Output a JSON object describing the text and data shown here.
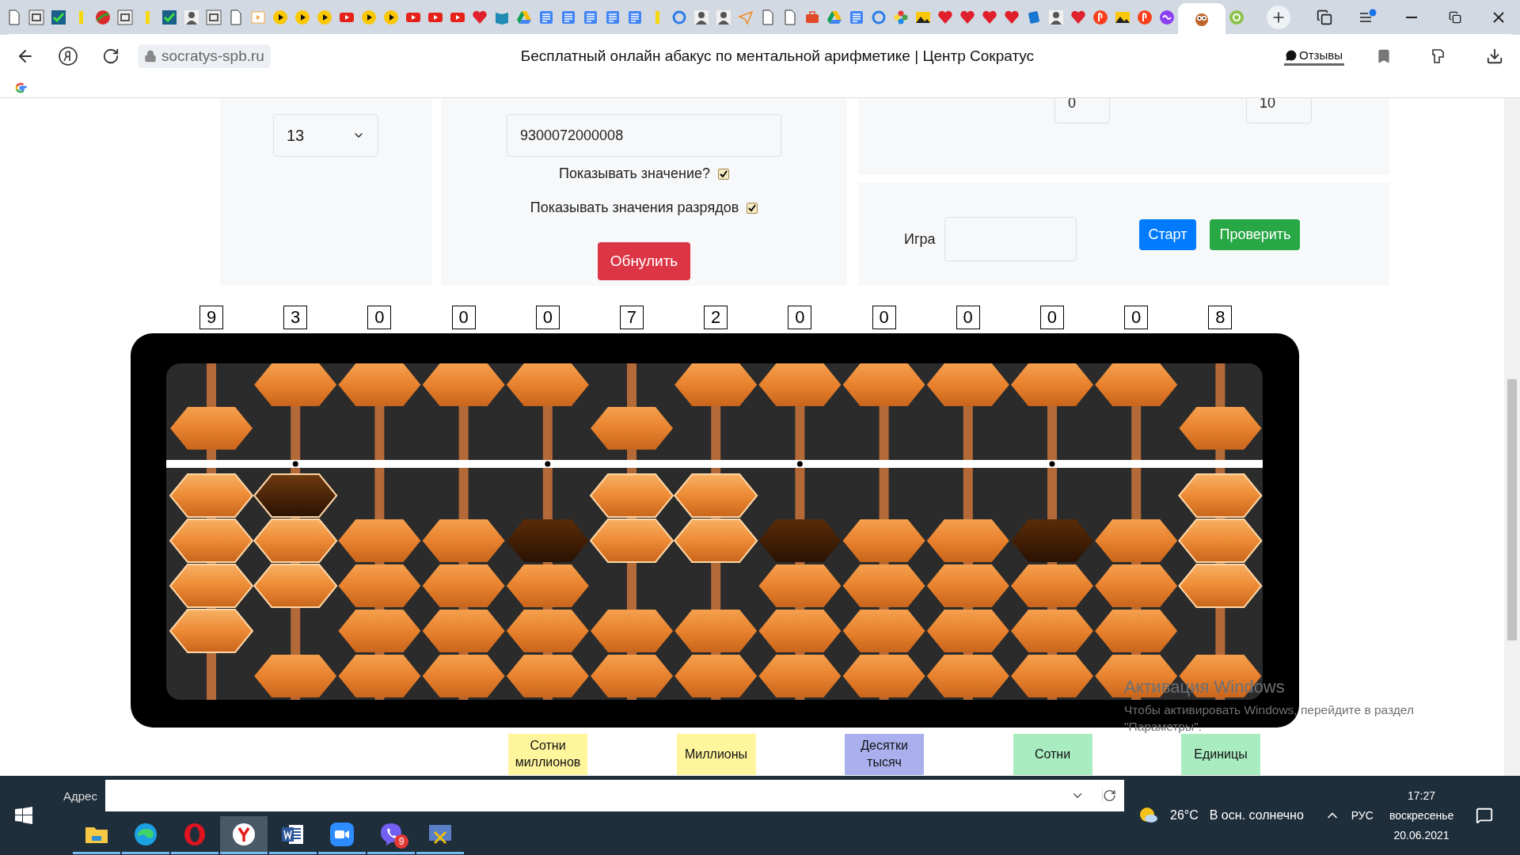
{
  "browser": {
    "tabs": [
      {
        "kind": "doc",
        "selected": false
      },
      {
        "kind": "letter",
        "selected": false
      },
      {
        "kind": "check",
        "selected": false
      },
      {
        "kind": "bar",
        "selected": false
      },
      {
        "kind": "ball",
        "selected": false
      },
      {
        "kind": "letter",
        "selected": false
      },
      {
        "kind": "bar",
        "selected": false
      },
      {
        "kind": "check",
        "selected": false
      },
      {
        "kind": "figure",
        "selected": false
      },
      {
        "kind": "letter",
        "selected": false
      },
      {
        "kind": "doc",
        "selected": false
      },
      {
        "kind": "slides",
        "selected": false
      },
      {
        "kind": "play",
        "selected": false
      },
      {
        "kind": "play",
        "selected": false
      },
      {
        "kind": "play",
        "selected": false
      },
      {
        "kind": "video",
        "selected": false
      },
      {
        "kind": "play",
        "selected": false
      },
      {
        "kind": "play",
        "selected": false
      },
      {
        "kind": "video",
        "selected": false
      },
      {
        "kind": "video",
        "selected": false
      },
      {
        "kind": "video",
        "selected": false
      },
      {
        "kind": "heart",
        "selected": false
      },
      {
        "kind": "book",
        "selected": false
      },
      {
        "kind": "drive",
        "selected": false
      },
      {
        "kind": "docs",
        "selected": false
      },
      {
        "kind": "docs",
        "selected": false
      },
      {
        "kind": "docs",
        "selected": false
      },
      {
        "kind": "docs",
        "selected": false
      },
      {
        "kind": "docs",
        "selected": false
      },
      {
        "kind": "bar",
        "selected": false
      },
      {
        "kind": "ring",
        "selected": false
      },
      {
        "kind": "figure",
        "selected": false
      },
      {
        "kind": "figure",
        "selected": false
      },
      {
        "kind": "plane",
        "selected": false
      },
      {
        "kind": "doc",
        "selected": false
      },
      {
        "kind": "doc",
        "selected": false
      },
      {
        "kind": "briefcase",
        "selected": false
      },
      {
        "kind": "drive",
        "selected": false
      },
      {
        "kind": "docs",
        "selected": false
      },
      {
        "kind": "ring",
        "selected": false
      },
      {
        "kind": "flower",
        "selected": false
      },
      {
        "kind": "image",
        "selected": false
      },
      {
        "kind": "heart",
        "selected": false
      },
      {
        "kind": "heart",
        "selected": false
      },
      {
        "kind": "heart",
        "selected": false
      },
      {
        "kind": "heart",
        "selected": false
      },
      {
        "kind": "card",
        "selected": false
      },
      {
        "kind": "figure",
        "selected": false
      },
      {
        "kind": "heart",
        "selected": false
      },
      {
        "kind": "ya",
        "selected": false
      },
      {
        "kind": "image",
        "selected": false
      },
      {
        "kind": "ya",
        "selected": false
      },
      {
        "kind": "swirl",
        "selected": false
      },
      {
        "kind": "owl",
        "selected": true
      },
      {
        "kind": "green",
        "selected": false
      }
    ],
    "address": "socratys-spb.ru",
    "page_title": "Бесплатный онлайн абакус по ментальной арифметике | Центр Сократус",
    "reviews_button": "Отзывы"
  },
  "settings": {
    "digits_select": "13",
    "value_input": "9300072000008",
    "options": [
      {
        "label": "Показывать значение?",
        "checked": true
      },
      {
        "label": "Показывать значения разрядов",
        "checked": true
      }
    ],
    "reset_button": "Обнулить",
    "range_from": "0",
    "range_to": "10",
    "game_label": "Игра",
    "start_button": "Старт",
    "check_button": "Проверить"
  },
  "abacus": {
    "columns": [
      {
        "digit": "9",
        "upper_down": true,
        "unit_dot": false,
        "lower": [
          {
            "up": true,
            "dark": false
          },
          {
            "up": true,
            "dark": false
          },
          {
            "up": true,
            "dark": false
          },
          {
            "up": true,
            "dark": false
          }
        ]
      },
      {
        "digit": "3",
        "upper_down": false,
        "unit_dot": true,
        "lower": [
          {
            "up": true,
            "dark": true
          },
          {
            "up": true,
            "dark": false
          },
          {
            "up": true,
            "dark": false
          },
          {
            "up": false,
            "dark": false
          }
        ]
      },
      {
        "digit": "0",
        "upper_down": false,
        "unit_dot": false,
        "lower": [
          {
            "up": false,
            "dark": false
          },
          {
            "up": false,
            "dark": false
          },
          {
            "up": false,
            "dark": false
          },
          {
            "up": false,
            "dark": false
          }
        ]
      },
      {
        "digit": "0",
        "upper_down": false,
        "unit_dot": false,
        "lower": [
          {
            "up": false,
            "dark": false
          },
          {
            "up": false,
            "dark": false
          },
          {
            "up": false,
            "dark": false
          },
          {
            "up": false,
            "dark": false
          }
        ]
      },
      {
        "digit": "0",
        "upper_down": false,
        "unit_dot": true,
        "lower": [
          {
            "up": false,
            "dark": true
          },
          {
            "up": false,
            "dark": false
          },
          {
            "up": false,
            "dark": false
          },
          {
            "up": false,
            "dark": false
          }
        ]
      },
      {
        "digit": "7",
        "upper_down": true,
        "unit_dot": false,
        "lower": [
          {
            "up": true,
            "dark": false
          },
          {
            "up": true,
            "dark": false
          },
          {
            "up": false,
            "dark": false
          },
          {
            "up": false,
            "dark": false
          }
        ]
      },
      {
        "digit": "2",
        "upper_down": false,
        "unit_dot": false,
        "lower": [
          {
            "up": true,
            "dark": false
          },
          {
            "up": true,
            "dark": false
          },
          {
            "up": false,
            "dark": false
          },
          {
            "up": false,
            "dark": false
          }
        ]
      },
      {
        "digit": "0",
        "upper_down": false,
        "unit_dot": true,
        "lower": [
          {
            "up": false,
            "dark": true
          },
          {
            "up": false,
            "dark": false
          },
          {
            "up": false,
            "dark": false
          },
          {
            "up": false,
            "dark": false
          }
        ]
      },
      {
        "digit": "0",
        "upper_down": false,
        "unit_dot": false,
        "lower": [
          {
            "up": false,
            "dark": false
          },
          {
            "up": false,
            "dark": false
          },
          {
            "up": false,
            "dark": false
          },
          {
            "up": false,
            "dark": false
          }
        ]
      },
      {
        "digit": "0",
        "upper_down": false,
        "unit_dot": false,
        "lower": [
          {
            "up": false,
            "dark": false
          },
          {
            "up": false,
            "dark": false
          },
          {
            "up": false,
            "dark": false
          },
          {
            "up": false,
            "dark": false
          }
        ]
      },
      {
        "digit": "0",
        "upper_down": false,
        "unit_dot": true,
        "lower": [
          {
            "up": false,
            "dark": true
          },
          {
            "up": false,
            "dark": false
          },
          {
            "up": false,
            "dark": false
          },
          {
            "up": false,
            "dark": false
          }
        ]
      },
      {
        "digit": "0",
        "upper_down": false,
        "unit_dot": false,
        "lower": [
          {
            "up": false,
            "dark": false
          },
          {
            "up": false,
            "dark": false
          },
          {
            "up": false,
            "dark": false
          },
          {
            "up": false,
            "dark": false
          }
        ]
      },
      {
        "digit": "8",
        "upper_down": true,
        "unit_dot": false,
        "lower": [
          {
            "up": true,
            "dark": false
          },
          {
            "up": true,
            "dark": false
          },
          {
            "up": true,
            "dark": false
          },
          {
            "up": false,
            "dark": false
          }
        ]
      }
    ]
  },
  "place_labels": [
    {
      "text": "Сотни миллионов",
      "color": "#fff59d"
    },
    {
      "text": "Миллионы",
      "color": "#fff59d"
    },
    {
      "text": "Десятки тысяч",
      "color": "#aab0ee"
    },
    {
      "text": "Сотни",
      "color": "#a8ecc0"
    },
    {
      "text": "Единицы",
      "color": "#a8ecc0"
    }
  ],
  "windows_notice": {
    "title": "Активация Windows",
    "text": "Чтобы активировать Windows, перейдите в раздел \"Параметры\"."
  },
  "taskbar": {
    "address_label": "Адрес",
    "apps": [
      {
        "kind": "explorer",
        "selected": false
      },
      {
        "kind": "edge",
        "selected": false
      },
      {
        "kind": "opera",
        "selected": false
      },
      {
        "kind": "yandex",
        "selected": true
      },
      {
        "kind": "word",
        "selected": false
      },
      {
        "kind": "zoom",
        "selected": false
      },
      {
        "kind": "viber",
        "selected": false,
        "badge": "9"
      },
      {
        "kind": "snip",
        "selected": false
      }
    ],
    "weather_temp": "26°C",
    "weather_text": "В осн. солнечно",
    "language": "РУС",
    "time": "17:27",
    "weekday": "воскресенье",
    "date": "20.06.2021"
  }
}
